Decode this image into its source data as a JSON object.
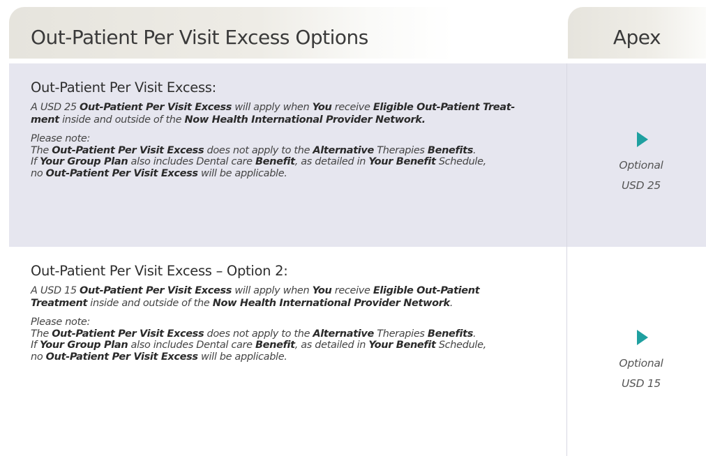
{
  "header": {
    "title": "Out-Patient Per Visit Excess Options",
    "column": "Apex"
  },
  "sections": [
    {
      "title": "Out-Patient Per Visit Excess:",
      "body": [
        [
          "A USD 25 ",
          false
        ],
        [
          "Out-Patient Per Visit Excess",
          true
        ],
        [
          " will apply when ",
          false
        ],
        [
          "You",
          true
        ],
        [
          " receive ",
          false
        ],
        [
          "Eligible Out-Patient Treat-",
          true
        ],
        [
          "\n",
          false
        ],
        [
          "ment",
          true
        ],
        [
          " inside and outside of the ",
          false
        ],
        [
          "Now Health International Provider Network.",
          true
        ]
      ],
      "note": [
        [
          "Please note:",
          false
        ],
        [
          "\n",
          false
        ],
        [
          "The ",
          false
        ],
        [
          "Out-Patient Per Visit Excess",
          true
        ],
        [
          " does not apply to the ",
          false
        ],
        [
          "Alternative",
          true
        ],
        [
          " Therapies ",
          false
        ],
        [
          "Benefits",
          true
        ],
        [
          ".",
          false
        ],
        [
          "\n",
          false
        ],
        [
          "If ",
          false
        ],
        [
          "Your Group Plan",
          true
        ],
        [
          " also includes Dental care ",
          false
        ],
        [
          "Benefit",
          true
        ],
        [
          ", as detailed in ",
          false
        ],
        [
          "Your Benefit",
          true
        ],
        [
          " Schedule,",
          false
        ],
        [
          "\n",
          false
        ],
        [
          "no ",
          false
        ],
        [
          "Out-Patient Per Visit Excess",
          true
        ],
        [
          " will be applicable.",
          false
        ]
      ],
      "option_label": "Optional",
      "option_value": "USD 25"
    },
    {
      "title": "Out-Patient Per Visit Excess – Option 2:",
      "body": [
        [
          "A USD 15 ",
          false
        ],
        [
          "Out-Patient Per Visit Excess",
          true
        ],
        [
          " will apply when ",
          false
        ],
        [
          "You",
          true
        ],
        [
          " receive ",
          false
        ],
        [
          "Eligible Out-Patient",
          true
        ],
        [
          "\n",
          false
        ],
        [
          "Treatment",
          true
        ],
        [
          " inside and outside of the ",
          false
        ],
        [
          "Now Health International Provider Network",
          true
        ],
        [
          ".",
          false
        ]
      ],
      "note": [
        [
          "Please note:",
          false
        ],
        [
          "\n",
          false
        ],
        [
          "The ",
          false
        ],
        [
          "Out-Patient Per Visit Excess",
          true
        ],
        [
          " does not apply to the ",
          false
        ],
        [
          "Alternative",
          true
        ],
        [
          " Therapies ",
          false
        ],
        [
          "Benefits",
          true
        ],
        [
          ".",
          false
        ],
        [
          "\n",
          false
        ],
        [
          "If ",
          false
        ],
        [
          "Your Group Plan",
          true
        ],
        [
          " also includes Dental care ",
          false
        ],
        [
          "Benefit",
          true
        ],
        [
          ", as detailed in ",
          false
        ],
        [
          "Your Benefit",
          true
        ],
        [
          " Schedule,",
          false
        ],
        [
          "\n",
          false
        ],
        [
          "no ",
          false
        ],
        [
          "Out-Patient Per Visit Excess",
          true
        ],
        [
          " will be applicable.",
          false
        ]
      ],
      "option_label": "Optional",
      "option_value": "USD 15"
    }
  ],
  "colors": {
    "accent_arrow": "#1fa0a0",
    "band": "#e6e6ef",
    "header_bg": "#e6e4dd"
  },
  "icons": {
    "option_marker": "play-arrow-icon"
  }
}
